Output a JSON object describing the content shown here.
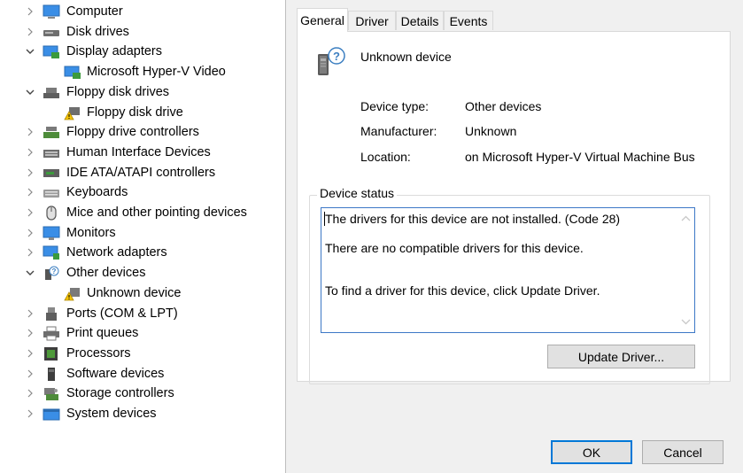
{
  "tree": {
    "items": [
      {
        "label": "Computer",
        "state": "collapsed",
        "icon": "computer-icon"
      },
      {
        "label": "Disk drives",
        "state": "collapsed",
        "icon": "disk-drive-icon"
      },
      {
        "label": "Display adapters",
        "state": "expanded",
        "icon": "display-adapter-icon"
      },
      {
        "label": "Microsoft Hyper-V Video",
        "state": "child",
        "icon": "display-adapter-icon"
      },
      {
        "label": "Floppy disk drives",
        "state": "expanded",
        "icon": "floppy-drive-icon"
      },
      {
        "label": "Floppy disk drive",
        "state": "child",
        "icon": "floppy-warning-icon"
      },
      {
        "label": "Floppy drive controllers",
        "state": "collapsed",
        "icon": "floppy-controller-icon"
      },
      {
        "label": "Human Interface Devices",
        "state": "collapsed",
        "icon": "hid-icon"
      },
      {
        "label": "IDE ATA/ATAPI controllers",
        "state": "collapsed",
        "icon": "ide-controller-icon"
      },
      {
        "label": "Keyboards",
        "state": "collapsed",
        "icon": "keyboard-icon"
      },
      {
        "label": "Mice and other pointing devices",
        "state": "collapsed",
        "icon": "mouse-icon"
      },
      {
        "label": "Monitors",
        "state": "collapsed",
        "icon": "monitor-icon"
      },
      {
        "label": "Network adapters",
        "state": "collapsed",
        "icon": "network-adapter-icon"
      },
      {
        "label": "Other devices",
        "state": "expanded",
        "icon": "other-devices-icon"
      },
      {
        "label": "Unknown device",
        "state": "child",
        "icon": "unknown-device-warning-icon"
      },
      {
        "label": "Ports (COM & LPT)",
        "state": "collapsed",
        "icon": "port-icon"
      },
      {
        "label": "Print queues",
        "state": "collapsed",
        "icon": "printer-icon"
      },
      {
        "label": "Processors",
        "state": "collapsed",
        "icon": "processor-icon"
      },
      {
        "label": "Software devices",
        "state": "collapsed",
        "icon": "software-device-icon"
      },
      {
        "label": "Storage controllers",
        "state": "collapsed",
        "icon": "storage-controller-icon"
      },
      {
        "label": "System devices",
        "state": "collapsed",
        "icon": "system-devices-icon"
      }
    ]
  },
  "dialog": {
    "tabs": [
      {
        "label": "General",
        "active": true
      },
      {
        "label": "Driver",
        "active": false
      },
      {
        "label": "Details",
        "active": false
      },
      {
        "label": "Events",
        "active": false
      }
    ],
    "device_name": "Unknown device",
    "device_icon": "unknown-device-icon",
    "properties": {
      "type_label": "Device type:",
      "type_value": "Other devices",
      "manufacturer_label": "Manufacturer:",
      "manufacturer_value": "Unknown",
      "location_label": "Location:",
      "location_value": "on Microsoft Hyper-V Virtual Machine Bus"
    },
    "status_group_title": "Device status",
    "status_lines": [
      "The drivers for this device are not installed. (Code 28)",
      "There are no compatible drivers for this device.",
      "To find a driver for this device, click Update Driver."
    ],
    "update_driver_label": "Update Driver...",
    "ok_label": "OK",
    "cancel_label": "Cancel"
  },
  "colors": {
    "focus_blue": "#0078d7",
    "dialog_bg": "#f0f0f0",
    "warning_yellow": "#f5c400"
  }
}
